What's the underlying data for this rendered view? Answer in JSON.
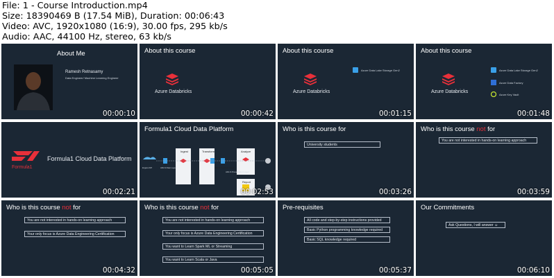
{
  "file_info": {
    "line1": "File: 1 - Course Introduction.mp4",
    "line2": "Size: 18390469 B (17.54 MiB), Duration: 00:06:43",
    "line3": "Video: AVC, 1920x1080 (16:9), 30.00 fps, 295 kb/s",
    "line4": "Audio: AAC, 44100 Hz, stereo, 63 kb/s"
  },
  "thumbs": [
    {
      "title": "About Me",
      "ts": "00:00:10",
      "name": "Ramesh Retnasamy",
      "role": "Data Engineer/ Machine Learning Engineer"
    },
    {
      "title": "About this course",
      "ts": "00:00:42",
      "db": "Azure Databricks"
    },
    {
      "title": "About this course",
      "ts": "00:01:15",
      "db": "Azure Databricks",
      "adls": "Azure Data Lake Storage Gen2"
    },
    {
      "title": "About this course",
      "ts": "00:01:48",
      "db": "Azure Databricks",
      "adls": "Azure Data Lake Storage Gen2",
      "adf": "Azure Data Factory",
      "kv": "Azure Key Vault"
    },
    {
      "title": "Formula1 Cloud Data Platform",
      "ts": "00:02:21",
      "logo": "Formula1"
    },
    {
      "title": "Formula1 Cloud Data Platform",
      "ts": "00:02:53",
      "stages": [
        "Ingest",
        "Transform",
        "Analyze",
        "Report"
      ],
      "source": "Ergast API",
      "raw": "ADLS Raw Layer",
      "ingested": "ADLS Ingested Layer",
      "presentation": "ADLS Presentation Layer"
    },
    {
      "title": "Who is this course for",
      "ts": "00:03:26",
      "items": [
        "University students"
      ]
    },
    {
      "title_a": "Who is this course ",
      "title_b": "not",
      "title_c": " for",
      "ts": "00:03:59",
      "items": [
        "You are not interested in hands-on learning approach"
      ]
    },
    {
      "title_a": "Who is this course ",
      "title_b": "not",
      "title_c": " for",
      "ts": "00:04:32",
      "items": [
        "You are not interested in hands-on learning approach",
        "Your only focus is Azure Data Engineering Certification"
      ]
    },
    {
      "title_a": "Who is this course ",
      "title_b": "not",
      "title_c": " for",
      "ts": "00:05:05",
      "items": [
        "You are not interested in hands-on learning approach",
        "Your only focus is Azure Data Engineering Certification",
        "You want to Learn Spark ML or Streaming",
        "You want to Learn Scala or Java"
      ]
    },
    {
      "title": "Pre-requisites",
      "ts": "00:05:37",
      "items": [
        "All code and step-by-step instructions provided",
        "Basic Python programming knowledge required",
        "Basic SQL knowledge required"
      ]
    },
    {
      "title": "Our Commitments",
      "ts": "00:06:10",
      "items": [
        "Ask Questions, I will answer ☺"
      ]
    }
  ],
  "colors": {
    "slide_bg": "#1b2734",
    "accent_red": "#e8303a",
    "databricks_red": "#e8303a"
  }
}
